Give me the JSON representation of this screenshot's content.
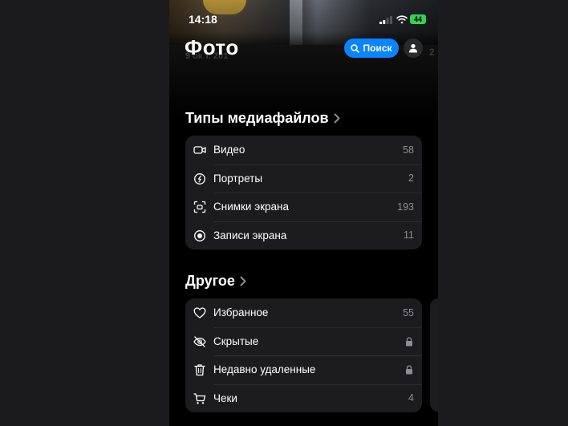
{
  "status": {
    "time": "14:18",
    "battery": "44"
  },
  "header": {
    "title": "Фото",
    "search_label": "Поиск"
  },
  "background_text": {
    "left": "9 ок т. 201",
    "right": "2"
  },
  "media_types": {
    "heading": "Типы медиафайлов",
    "items": [
      {
        "icon": "video-icon",
        "label": "Видео",
        "count": "58"
      },
      {
        "icon": "portrait-icon",
        "label": "Портреты",
        "count": "2"
      },
      {
        "icon": "screenshot-icon",
        "label": "Снимки экрана",
        "count": "193"
      },
      {
        "icon": "screen-recording-icon",
        "label": "Записи экрана",
        "count": "11"
      }
    ]
  },
  "other": {
    "heading": "Другое",
    "items": [
      {
        "icon": "heart-icon",
        "label": "Избранное",
        "count": "55",
        "locked": false
      },
      {
        "icon": "hidden-eye-icon",
        "label": "Скрытые",
        "count": "",
        "locked": true
      },
      {
        "icon": "trash-icon",
        "label": "Недавно удаленные",
        "count": "",
        "locked": true
      },
      {
        "icon": "cart-icon",
        "label": "Чеки",
        "count": "4",
        "locked": false
      }
    ]
  },
  "colors": {
    "accent": "#0a84ff",
    "card": "#1c1c1e",
    "secondary_text": "#8e8e93",
    "battery": "#30d158"
  }
}
